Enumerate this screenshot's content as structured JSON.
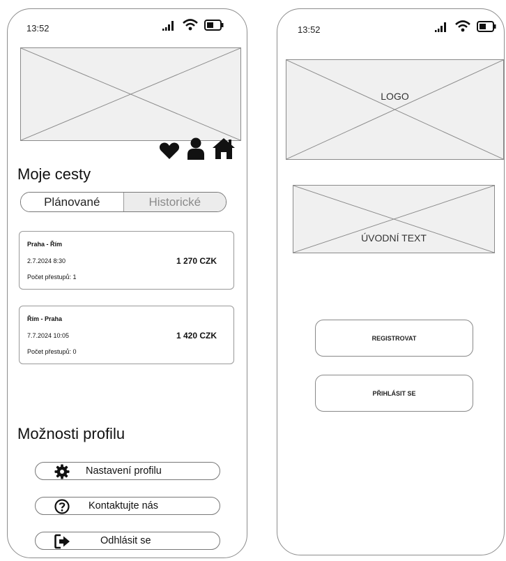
{
  "colors": {
    "frame": "#8c8c8c",
    "placeholder_fill": "#f0f0f0",
    "inactive_tab_bg": "#ececec",
    "inactive_tab_text": "#8a8a8a"
  },
  "left_screen": {
    "status_bar": {
      "time": "13:52",
      "icons": [
        "signal-icon",
        "wifi-icon",
        "battery-icon"
      ]
    },
    "header_icons": [
      "heart-icon",
      "user-icon",
      "home-icon"
    ],
    "trips_title": "Moje cesty",
    "tabs": [
      {
        "label": "Plánované",
        "active": true
      },
      {
        "label": "Historické",
        "active": false
      }
    ],
    "trips": [
      {
        "route": "Praha - Řím",
        "datetime": "2.7.2024 8:30",
        "price": "1 270 CZK",
        "transfers": "Počet přestupů: 1"
      },
      {
        "route": "Řím - Praha",
        "datetime": "7.7.2024 10:05",
        "price": "1 420 CZK",
        "transfers": "Počet přestupů: 0"
      }
    ],
    "profile_title": "Možnosti profilu",
    "profile_options": [
      {
        "label": "Nastavení profilu",
        "icon": "gear-icon"
      },
      {
        "label": "Kontaktujte nás",
        "icon": "question-icon"
      },
      {
        "label": "Odhlásit se",
        "icon": "logout-icon"
      }
    ]
  },
  "right_screen": {
    "status_bar": {
      "time": "13:52",
      "icons": [
        "signal-icon",
        "wifi-icon",
        "battery-icon"
      ]
    },
    "logo_label": "LOGO",
    "intro_label": "ÚVODNÍ TEXT",
    "register_label": "REGISTROVAT",
    "login_label": "PŘIHLÁSIT SE"
  }
}
